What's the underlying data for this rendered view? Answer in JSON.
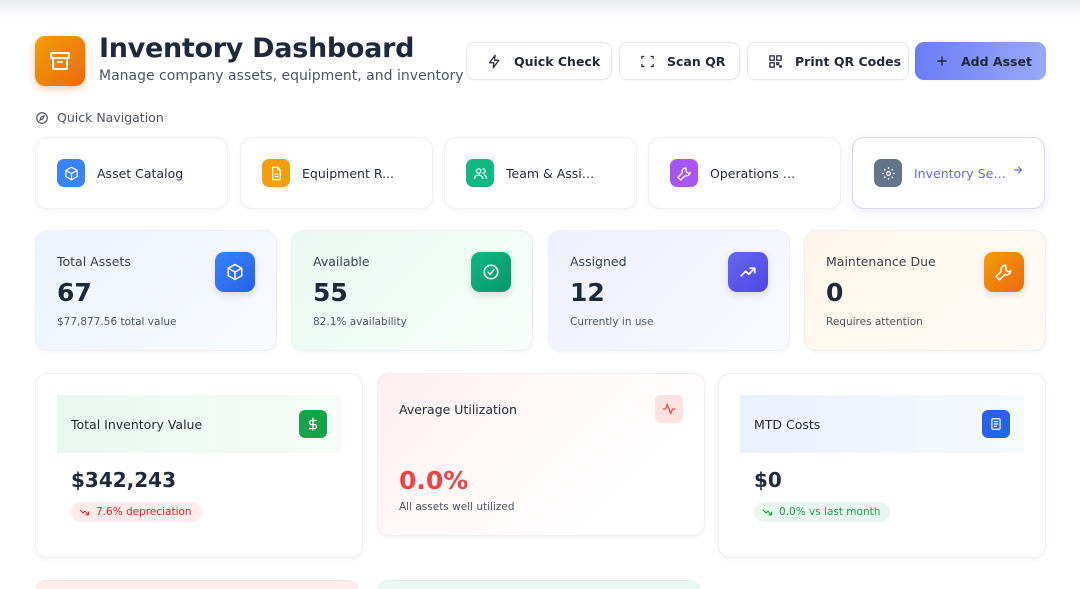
{
  "header": {
    "title": "Inventory Dashboard",
    "subtitle": "Manage company assets, equipment, and inventory",
    "buttons": {
      "quick_check": "Quick Check",
      "scan_qr": "Scan QR",
      "print_qr": "Print QR Codes",
      "add_asset": "Add Asset"
    }
  },
  "quick_nav": {
    "label": "Quick Navigation",
    "items": [
      {
        "label": "Asset Catalog",
        "icon": "box-icon",
        "color": "#3b82f6"
      },
      {
        "label": "Equipment R...",
        "icon": "document-icon",
        "color": "#f59e0b"
      },
      {
        "label": "Team & Assig...",
        "icon": "users-icon",
        "color": "#10b981"
      },
      {
        "label": "Operations C...",
        "icon": "wrench-icon",
        "color": "#a855f7"
      },
      {
        "label": "Inventory Set...",
        "icon": "gear-icon",
        "color": "#64748b"
      }
    ]
  },
  "stats": [
    {
      "label": "Total Assets",
      "value": "67",
      "sub": "$77,877.56 total value",
      "icon": "box-icon",
      "color": "#3b82f6"
    },
    {
      "label": "Available",
      "value": "55",
      "sub": "82.1% availability",
      "icon": "check-circle-icon",
      "color": "#10b981"
    },
    {
      "label": "Assigned",
      "value": "12",
      "sub": "Currently in use",
      "icon": "trending-up-icon",
      "color": "#6366f1"
    },
    {
      "label": "Maintenance Due",
      "value": "0",
      "sub": "Requires attention",
      "icon": "wrench-icon",
      "color": "#f59e0b"
    }
  ],
  "metrics": {
    "inventory_value": {
      "label": "Total Inventory Value",
      "value": "$342,243",
      "pill": "7.6% depreciation",
      "icon": "dollar-icon"
    },
    "utilization": {
      "label": "Average Utilization",
      "value": "0.0%",
      "sub": "All assets well utilized",
      "icon": "activity-icon"
    },
    "mtd_costs": {
      "label": "MTD Costs",
      "value": "$0",
      "pill": "0.0% vs last month",
      "icon": "receipt-icon"
    }
  },
  "colors": {
    "accent": "#6366f1",
    "danger": "#ef4444",
    "success": "#16a34a"
  }
}
